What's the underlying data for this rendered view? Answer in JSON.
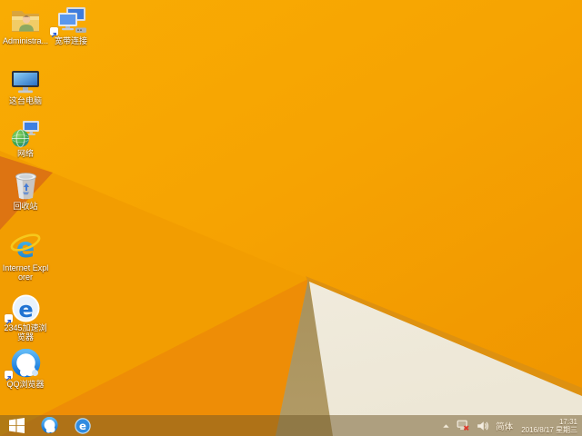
{
  "desktop": {
    "icons": [
      {
        "name": "administrator-folder",
        "label": "Administra..."
      },
      {
        "name": "broadband-connection",
        "label": "宽带连接",
        "shortcut": true
      },
      {
        "name": "this-pc",
        "label": "这台电脑"
      },
      {
        "name": "network",
        "label": "网络"
      },
      {
        "name": "recycle-bin",
        "label": "回收站"
      },
      {
        "name": "internet-explorer",
        "label": "Internet Explorer"
      },
      {
        "name": "2345-browser",
        "label": "2345加速浏览器",
        "shortcut": true
      },
      {
        "name": "qq-browser",
        "label": "QQ浏览器",
        "shortcut": true
      }
    ]
  },
  "taskbar": {
    "start_button": {
      "icon": "windows-logo"
    },
    "pinned_apps": [
      {
        "name": "qq-browser",
        "icon": "qq-browser-ring-cloud"
      },
      {
        "name": "2345-browser",
        "icon": "blue-circle-e"
      }
    ],
    "tray": {
      "hidden_icons": {
        "icon": "chevron-up"
      },
      "network": {
        "icon": "network-disconnected",
        "status": "disconnected"
      },
      "volume": {
        "icon": "speaker"
      },
      "input_method": "简体",
      "time": "17:31",
      "date": "2016/8/17 星期三"
    }
  },
  "colors": {
    "wallpaper_orange": "#F6A302",
    "wallpaper_dark_wedge": "#DD7412",
    "wallpaper_white_fold": "#F3EEE1",
    "wallpaper_tan_fold": "#A78F58",
    "wallpaper_gold_edge": "#DE9110",
    "taskbar_overlay": "rgba(112,88,40,0.5)",
    "icon_label_text": "#FFFFFF"
  }
}
